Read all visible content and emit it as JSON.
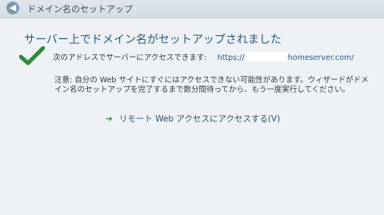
{
  "window": {
    "title": "ドメイン名のセットアップ",
    "back_icon": "back-arrow-icon"
  },
  "main": {
    "heading": "サーバー上でドメイン名がセットアップされました",
    "status_icon": "checkmark-icon",
    "address_label": "次のアドレスでサーバーにアクセスできます:",
    "url_prefix": "https://",
    "url_suffix": "homeserver.com/",
    "notice": "注意: 自分の Web サイトにすぐにはアクセスできない可能性があります。ウィザードがドメイン名のセットアップを完了するまで数分間待ってから、もう一度実行してください。",
    "remote_link": "リモート Web アクセスにアクセスする(V)"
  },
  "colors": {
    "heading": "#2b5a86",
    "check": "#2f8a3a",
    "link_arrow": "#2f8a3a"
  }
}
